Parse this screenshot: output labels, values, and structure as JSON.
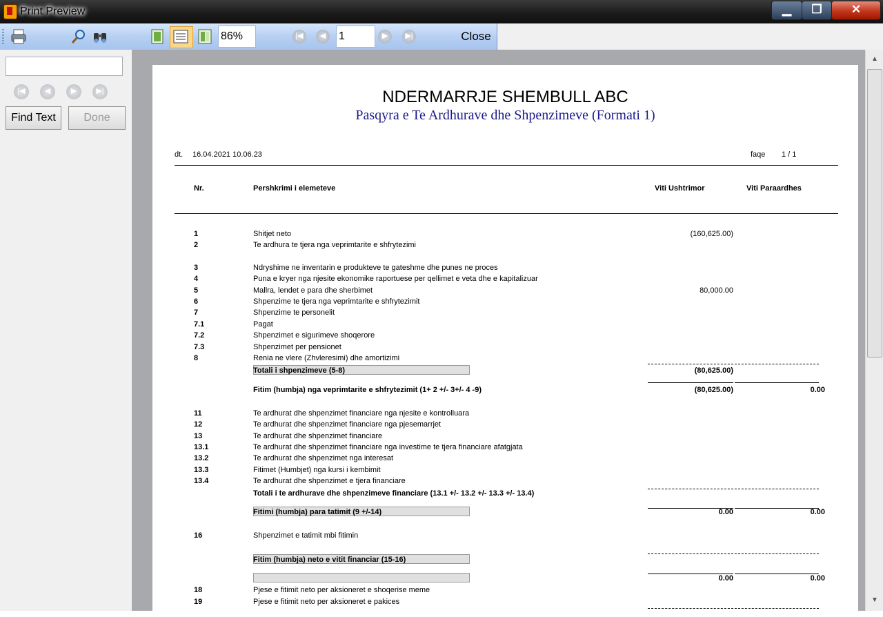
{
  "window": {
    "title": "Print Preview"
  },
  "toolbar": {
    "zoom": "86%",
    "page": "1",
    "close_label": "Close"
  },
  "find_panel": {
    "find_label": "Find Text",
    "done_label": "Done",
    "search_value": ""
  },
  "report": {
    "company": "NDERMARRJE SHEMBULL ABC",
    "subtitle": "Pasqyra e Te Ardhurave dhe Shpenzimeve (Formati 1)",
    "date_label": "dt.",
    "date_value": "16.04.2021  10.06.23",
    "page_label": "faqe",
    "page_value": "1   /   1",
    "columns": {
      "nr": "Nr.",
      "desc": "Pershkrimi i elemeteve",
      "current": "Viti Ushtrimor",
      "previous": "Viti Paraardhes"
    },
    "rows": [
      {
        "nr": "1",
        "desc": "Shitjet neto",
        "v1": "(160,625.00)",
        "v2": ""
      },
      {
        "nr": "2",
        "desc": "Te ardhura te tjera nga veprimtarite e shfrytezimi",
        "v1": "",
        "v2": ""
      },
      {
        "nr": "3",
        "desc": "Ndryshime ne inventarin e produkteve te gateshme dhe punes ne proces",
        "v1": "",
        "v2": ""
      },
      {
        "nr": "4",
        "desc": "Puna e kryer nga njesite ekonomike raportuese per qellimet e veta dhe e kapitalizuar",
        "v1": "",
        "v2": ""
      },
      {
        "nr": "5",
        "desc": "Mallra, lendet e para dhe sherbimet",
        "v1": "80,000.00",
        "v2": ""
      },
      {
        "nr": "6",
        "desc": "Shpenzime te tjera nga veprimtarite e shfrytezimit",
        "v1": "",
        "v2": ""
      },
      {
        "nr": "7",
        "desc": "Shpenzime te personelit",
        "v1": "",
        "v2": ""
      },
      {
        "nr": "7.1",
        "desc": "Pagat",
        "v1": "",
        "v2": ""
      },
      {
        "nr": "7.2",
        "desc": "Shpenzimet e sigurimeve shoqerore",
        "v1": "",
        "v2": ""
      },
      {
        "nr": "7.3",
        "desc": "Shpenzimet per pensionet",
        "v1": "",
        "v2": ""
      },
      {
        "nr": "8",
        "desc": "Renia ne vlere (Zhvleresimi) dhe amortizimi",
        "v1": "",
        "v2": ""
      },
      {
        "nr": "",
        "desc": "Totali i shpenzimeve (5-8)",
        "v1": "(80,625.00)",
        "v2": ""
      },
      {
        "nr": "",
        "desc": "Fitim (humbja) nga veprimtarite e shfrytezimit (1+ 2 +/- 3+/- 4 -9)",
        "v1": "(80,625.00)",
        "v2": "0.00"
      },
      {
        "nr": "11",
        "desc": "Te ardhurat dhe shpenzimet financiare nga njesite e kontrolluara",
        "v1": "",
        "v2": ""
      },
      {
        "nr": "12",
        "desc": "Te ardhurat dhe shpenzimet financiare nga pjesemarrjet",
        "v1": "",
        "v2": ""
      },
      {
        "nr": "13",
        "desc": "Te ardhurat dhe shpenzimet financiare",
        "v1": "",
        "v2": ""
      },
      {
        "nr": "13.1",
        "desc": "Te ardhurat dhe shpenzimet financiare nga investime te tjera financiare afatgjata",
        "v1": "",
        "v2": ""
      },
      {
        "nr": "13.2",
        "desc": "Te ardhurat dhe shpenzimet nga interesat",
        "v1": "",
        "v2": ""
      },
      {
        "nr": "13.3",
        "desc": "Fitimet (Humbjet) nga kursi i kembimit",
        "v1": "",
        "v2": ""
      },
      {
        "nr": "13.4",
        "desc": "Te ardhurat dhe shpenzimet e tjera financiare",
        "v1": "",
        "v2": ""
      },
      {
        "nr": "",
        "desc": "Totali i te ardhurave dhe shpenzimeve financiare (13.1 +/- 13.2 +/- 13.3 +/- 13.4)",
        "v1": "",
        "v2": ""
      },
      {
        "nr": "",
        "desc": "Fitimi (humbja) para tatimit (9 +/-14)",
        "v1": "0.00",
        "v2": "0.00"
      },
      {
        "nr": "16",
        "desc": "Shpenzimet e tatimit mbi fitimin",
        "v1": "",
        "v2": ""
      },
      {
        "nr": "",
        "desc": "Fitim (humbja) neto e vitit financiar  (15-16)",
        "v1": "",
        "v2": ""
      },
      {
        "nr": "",
        "desc": "",
        "v1": "0.00",
        "v2": "0.00"
      },
      {
        "nr": "18",
        "desc": "Pjese e fitimit neto per aksioneret e shoqerise meme",
        "v1": "",
        "v2": ""
      },
      {
        "nr": "19",
        "desc": "Pjese e fitimit neto per aksioneret e pakices",
        "v1": "",
        "v2": ""
      }
    ]
  }
}
